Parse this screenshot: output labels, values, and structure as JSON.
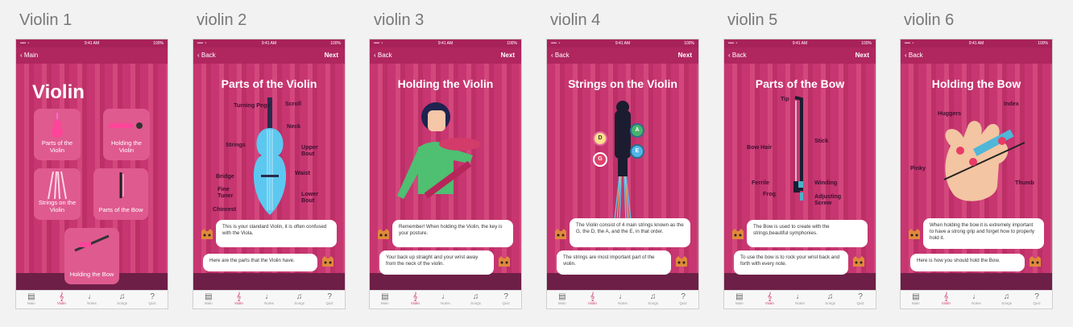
{
  "screens": [
    {
      "label": "Violin 1",
      "title": "Violin"
    },
    {
      "label": "violin 2",
      "title": "Parts of the Violin"
    },
    {
      "label": "violin 3",
      "title": "Holding the Violin"
    },
    {
      "label": "violin 4",
      "title": "Strings on the Violin"
    },
    {
      "label": "violin 5",
      "title": "Parts of the Bow"
    },
    {
      "label": "violin 6",
      "title": "Holding the Bow"
    }
  ],
  "statusbar": {
    "time": "9:41 AM",
    "battery": "100%",
    "signal": "•••• ◔"
  },
  "nav": {
    "main": "Main",
    "back": "Back",
    "next": "Next"
  },
  "tabs": [
    "Main",
    "Violin",
    "Notes",
    "Songs",
    "Quiz"
  ],
  "home_tiles": [
    "Parts of the Violin",
    "Holding the Violin",
    "Strings on the Violin",
    "Parts of the Bow",
    "Holding the Bow"
  ],
  "parts_labels": {
    "turning_pegs": "Turning Pegs",
    "scroll": "Scroll",
    "neck": "Neck",
    "strings": "Strings",
    "upper_bout": "Upper Bout",
    "bridge": "Bridge",
    "waist": "Waist",
    "fine_tuner": "Fine Tuner",
    "lower_bout": "Lower Bout",
    "chinrest": "Chinrest"
  },
  "bow_labels": {
    "tip": "Tip",
    "bow_hair": "Bow Hair",
    "stick": "Stick",
    "ferrile": "Ferrile",
    "frog": "Frog",
    "winding": "Winding",
    "adjusting_screw": "Adjusting Screw"
  },
  "hold_labels": {
    "huggers": "Huggers",
    "index": "Index",
    "pinky": "Pinky",
    "thumb": "Thumb"
  },
  "notes": [
    "D",
    "A",
    "E",
    "G"
  ],
  "bubbles": {
    "s2a": "This is your standard Violin, it is often confused with the Viola.",
    "s2b": "Here are the parts that the Violin have.",
    "s3a": "Remember! When holding the Violin, the key is your posture.",
    "s3b": "Your back up straight and your wrist away from the neck of the violin.",
    "s4a": "The Violin consist of 4 main strings known as the G, the D, the A, and the E, in that order.",
    "s4b": "The strings are most important part of the violin.",
    "s5a": "The Bow is used to create with the strings,beautiful symphonies.",
    "s5b": "To use the bow is to rock your wrist back and forth with every note.",
    "s6a": "When holding the bow it is extremely important to have a strong grip and forget how to properly hold it.",
    "s6b": "Here is how you should hold the Bow."
  },
  "page_dots": "● ● ● ● ●",
  "colors": {
    "accent": "#d0306c",
    "curtain": "#c73670",
    "tile": "#df5a8f"
  }
}
